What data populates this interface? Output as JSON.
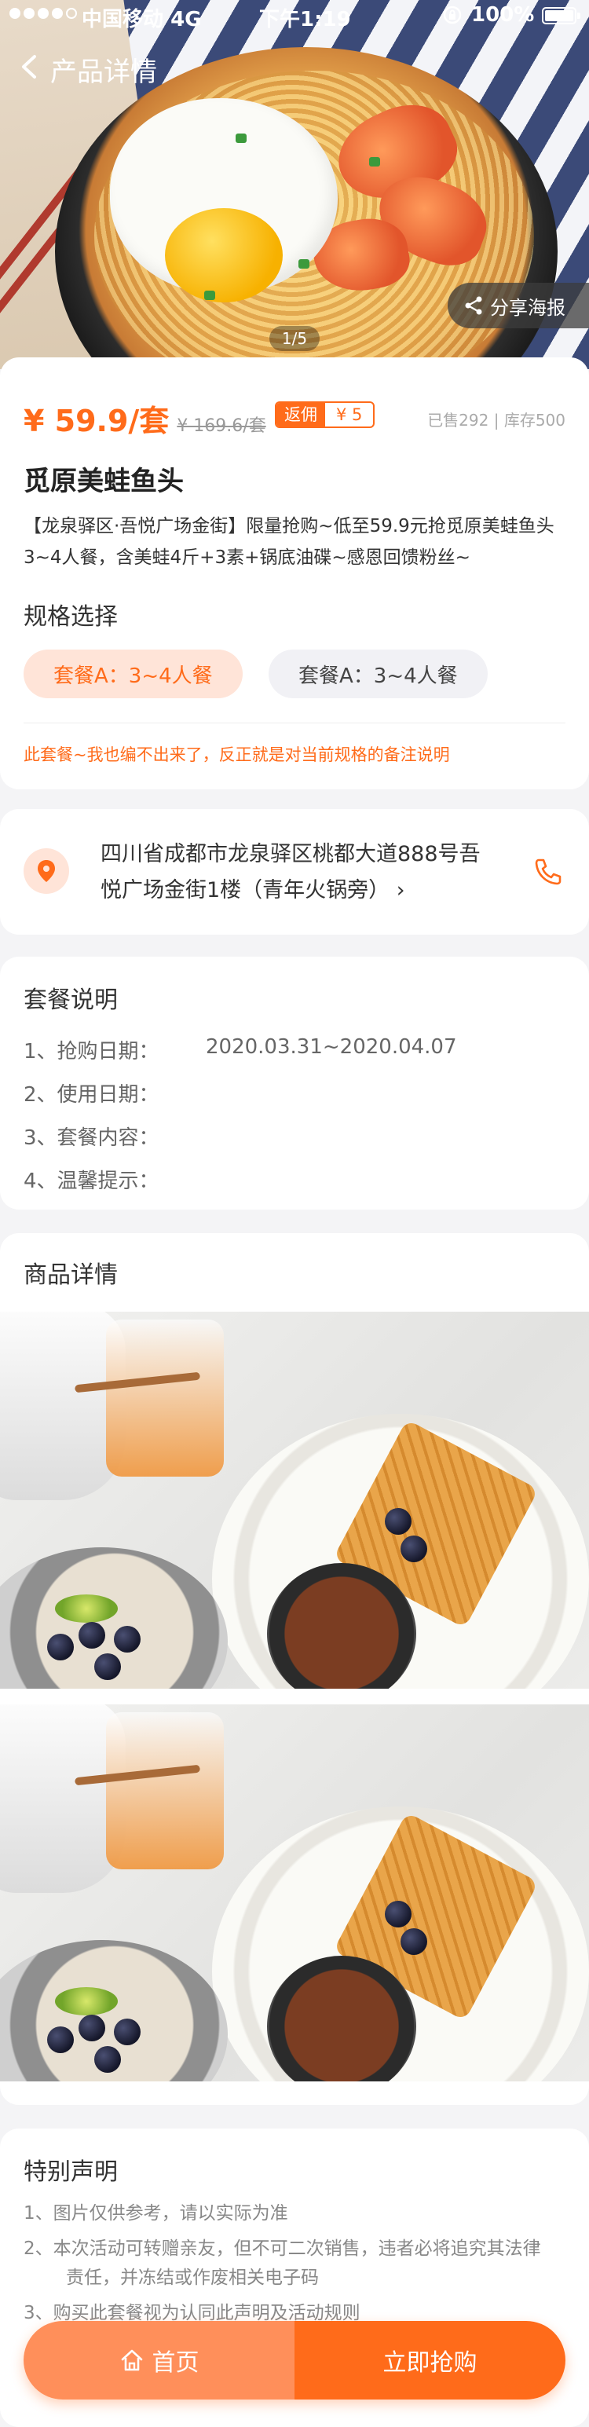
{
  "status_bar": {
    "carrier": "中国移动",
    "network": "4G",
    "time": "下午1:19",
    "battery": "100%"
  },
  "nav": {
    "title": "产品详情"
  },
  "hero": {
    "pager": "1/5",
    "share_label": "分享海报"
  },
  "product": {
    "price": "¥ 59.9/套",
    "original_price": "¥ 169.6/套",
    "rebate_label": "返佣",
    "rebate_value": "¥ 5",
    "sales": "已售292 | 库存500",
    "title": "觅原美蛙鱼头",
    "description": "【龙泉驿区·吾悦广场金街】限量抢购~低至59.9元抢觅原美蛙鱼头3~4人餐，含美蛙4斤+3素+锅底油碟~感恩回馈粉丝~",
    "spec_heading": "规格选择",
    "specs": [
      "套餐A：3~4人餐",
      "套餐A：3~4人餐"
    ],
    "spec_note": "此套餐~我也编不出来了，反正就是对当前规格的备注说明"
  },
  "address": {
    "text": "四川省成都市龙泉驿区桃都大道888号吾悦广场金街1楼（青年火锅旁）",
    "arrow": "›"
  },
  "package": {
    "heading": "套餐说明",
    "rows": [
      {
        "label": "1、抢购日期：",
        "value": "2020.03.31~2020.04.07"
      },
      {
        "label": "2、使用日期：",
        "value": ""
      },
      {
        "label": "3、套餐内容：",
        "value": ""
      },
      {
        "label": "4、温馨提示：",
        "value": ""
      }
    ]
  },
  "detail": {
    "heading": "商品详情"
  },
  "statement": {
    "heading": "特别声明",
    "lines": [
      "1、图片仅供参考，请以实际为准",
      "2、本次活动可转赠亲友，但不可二次销售，违者必将追究其法律",
      "责任，并冻结或作废相关电子码",
      "3、购买此套餐视为认同此声明及活动规则"
    ]
  },
  "bottom": {
    "home_label": "首页",
    "buy_label": "立即抢购"
  },
  "colors": {
    "accent": "#ff6b1a",
    "accent_light": "#ff8f5a",
    "background": "#f4f4f6"
  }
}
